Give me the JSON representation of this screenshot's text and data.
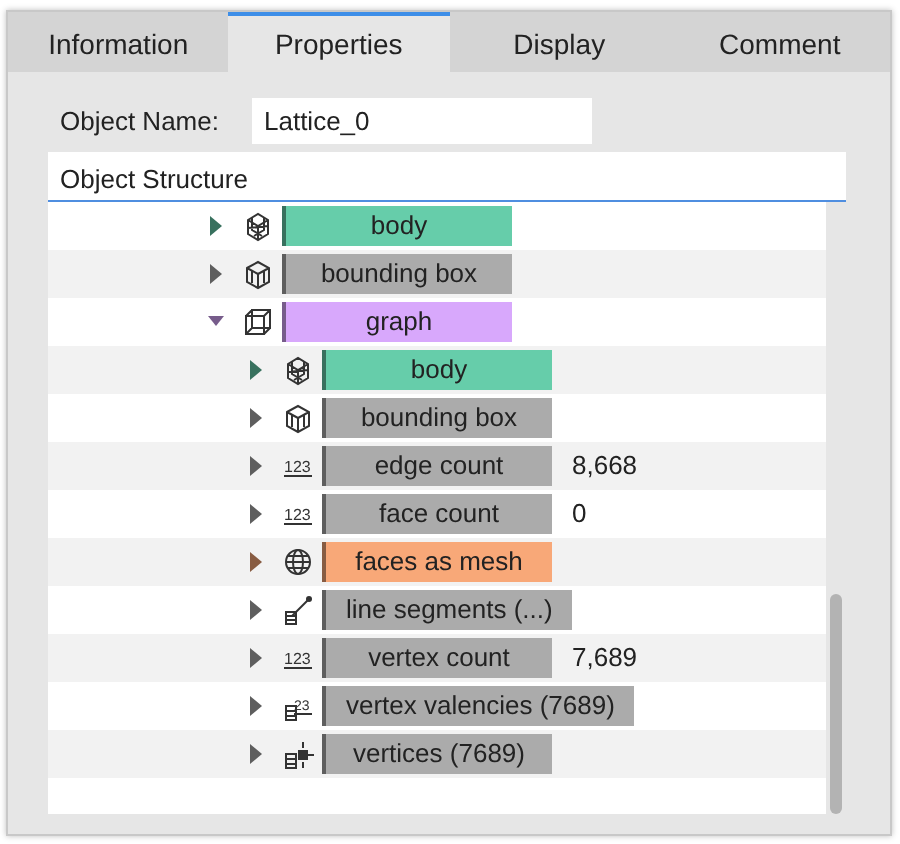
{
  "tabs": [
    {
      "label": "Information",
      "selected": false
    },
    {
      "label": "Properties",
      "selected": true
    },
    {
      "label": "Display",
      "selected": false
    },
    {
      "label": "Comment",
      "selected": false
    }
  ],
  "object_name": {
    "label": "Object Name:",
    "value": "Lattice_0"
  },
  "structure": {
    "title": "Object Structure",
    "items": [
      {
        "label": "body",
        "kind": "body",
        "color": "#66cdaa",
        "expanded": false
      },
      {
        "label": "bounding box",
        "kind": "box",
        "color": "#ababab",
        "expanded": false
      },
      {
        "label": "graph",
        "kind": "graph",
        "color": "#d8a8fc",
        "expanded": true,
        "children": [
          {
            "label": "body",
            "kind": "body",
            "color": "#66cdaa",
            "expanded": false
          },
          {
            "label": "bounding box",
            "kind": "box",
            "color": "#ababab",
            "expanded": false
          },
          {
            "label": "edge count",
            "kind": "number",
            "icon_text": "123",
            "color": "#ababab",
            "expanded": false,
            "value": "8,668"
          },
          {
            "label": "face count",
            "kind": "number",
            "icon_text": "123",
            "color": "#ababab",
            "expanded": false,
            "value": "0"
          },
          {
            "label": "faces as mesh",
            "kind": "mesh",
            "color": "#f8a878",
            "expanded": false
          },
          {
            "label": "line segments (...)",
            "kind": "segments",
            "color": "#ababab",
            "expanded": false
          },
          {
            "label": "vertex count",
            "kind": "number",
            "icon_text": "123",
            "color": "#ababab",
            "expanded": false,
            "value": "7,689"
          },
          {
            "label": "vertex valencies (7689)",
            "kind": "valencies",
            "icon_text": "23",
            "color": "#ababab",
            "expanded": false
          },
          {
            "label": "vertices (7689)",
            "kind": "vertices",
            "color": "#ababab",
            "expanded": false
          }
        ]
      }
    ]
  }
}
